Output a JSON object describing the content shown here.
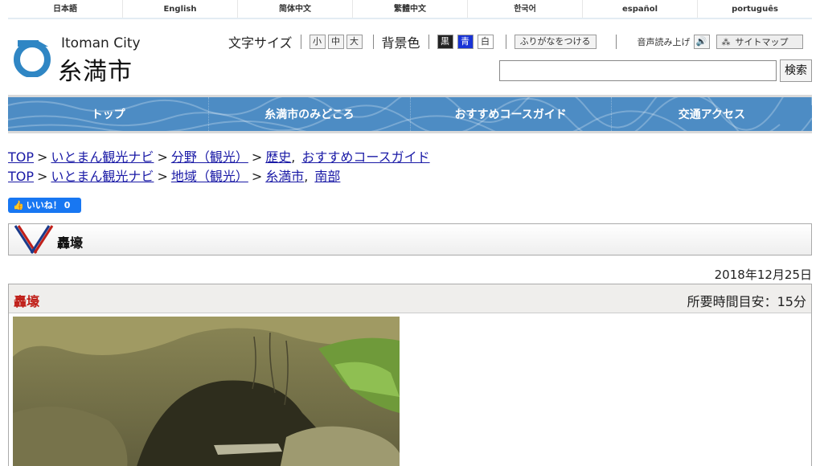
{
  "languages": [
    "日本語",
    "English",
    "简体中文",
    "繁體中文",
    "한국어",
    "español",
    "português"
  ],
  "logo": {
    "en": "Itoman City",
    "ja": "糸満市"
  },
  "utils": {
    "font_size_label": "文字サイズ",
    "font_sizes": [
      "小",
      "中",
      "大"
    ],
    "bg_label": "背景色",
    "bg_colors": [
      "黒",
      "青",
      "白"
    ],
    "furigana": "ふりがなをつける",
    "voice": "音声読み上げ",
    "sitemap": "サイトマップ"
  },
  "search": {
    "button": "検索",
    "value": ""
  },
  "nav": [
    "トップ",
    "糸満市のみどころ",
    "おすすめコースガイド",
    "交通アクセス"
  ],
  "breadcrumbs": [
    {
      "top": "TOP",
      "navi": "いとまん観光ナビ",
      "cat": "分野（観光）",
      "leaf1": "歴史",
      "leaf2": "おすすめコースガイド"
    },
    {
      "top": "TOP",
      "navi": "いとまん観光ナビ",
      "cat": "地域（観光）",
      "leaf1": "糸満市",
      "leaf2": "南部"
    }
  ],
  "like": {
    "label": "いいね！",
    "count": "0"
  },
  "page_title": "轟壕",
  "date": "2018年12月25日",
  "article": {
    "name": "轟壕",
    "time": "所要時間目安：15分"
  },
  "colors": {
    "nav": "#4d8cc4",
    "accent_red": "#c0201a",
    "link": "#1a1aa6"
  }
}
